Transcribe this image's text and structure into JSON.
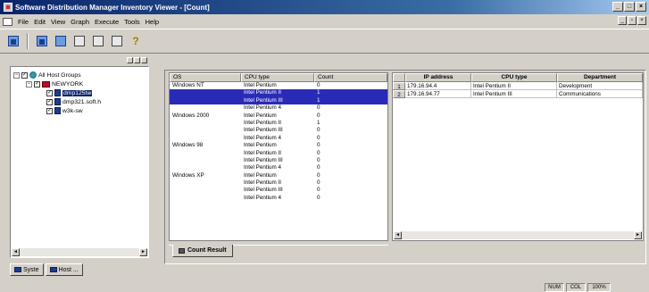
{
  "window": {
    "title": "Software Distribution Manager Inventory Viewer - [Count]",
    "controls": [
      "_",
      "□",
      "×"
    ]
  },
  "menu": {
    "items": [
      "File",
      "Edit",
      "View",
      "Graph",
      "Execute",
      "Tools",
      "Help"
    ],
    "mdi_controls": [
      "_",
      "▫",
      "×"
    ]
  },
  "tree": {
    "nodes": [
      {
        "label": "All Host Groups",
        "expander": "−"
      },
      {
        "label": "NEWYORK",
        "expander": "−"
      },
      {
        "label": "dmp125tw"
      },
      {
        "label": "dmp321.soft.h"
      },
      {
        "label": "w3k-sw"
      }
    ]
  },
  "left_tabs": [
    "Syste",
    "Host ..."
  ],
  "count_grid": {
    "columns": [
      "OS",
      "CPU type",
      "Count"
    ],
    "rows": [
      {
        "os": "Windows NT",
        "cpu": "Intel Pentium",
        "count": "0",
        "selected": false
      },
      {
        "os": "",
        "cpu": "Intel Pentium II",
        "count": "1",
        "selected": true
      },
      {
        "os": "",
        "cpu": "Intel Pentium III",
        "count": "1",
        "selected": true
      },
      {
        "os": "",
        "cpu": "Intel Pentium 4",
        "count": "0",
        "selected": false
      },
      {
        "os": "Windows 2000",
        "cpu": "Intel Pentium",
        "count": "0",
        "selected": false
      },
      {
        "os": "",
        "cpu": "Intel Pentium II",
        "count": "1",
        "selected": false
      },
      {
        "os": "",
        "cpu": "Intel Pentium III",
        "count": "0",
        "selected": false
      },
      {
        "os": "",
        "cpu": "Intel Pentium 4",
        "count": "0",
        "selected": false
      },
      {
        "os": "Windows 98",
        "cpu": "Intel Pentium",
        "count": "0",
        "selected": false
      },
      {
        "os": "",
        "cpu": "Intel Pentium II",
        "count": "0",
        "selected": false
      },
      {
        "os": "",
        "cpu": "Intel Pentium III",
        "count": "0",
        "selected": false
      },
      {
        "os": "",
        "cpu": "Intel Pentium 4",
        "count": "0",
        "selected": false
      },
      {
        "os": "Windows XP",
        "cpu": "Intel Pentium",
        "count": "0",
        "selected": false
      },
      {
        "os": "",
        "cpu": "Intel Pentium II",
        "count": "0",
        "selected": false
      },
      {
        "os": "",
        "cpu": "Intel Pentium III",
        "count": "0",
        "selected": false
      },
      {
        "os": "",
        "cpu": "Intel Pentium 4",
        "count": "0",
        "selected": false
      }
    ]
  },
  "result_tab": {
    "label": "Count Result"
  },
  "ip_grid": {
    "columns": [
      "IP address",
      "CPU type",
      "Department"
    ],
    "rows": [
      {
        "n": "1",
        "ip": "179.16.94.4",
        "cpu": "Intel Pentium II",
        "dept": "Development"
      },
      {
        "n": "2",
        "ip": "179.16.94.77",
        "cpu": "Intel Pentium III",
        "dept": "Communications"
      }
    ]
  },
  "status": [
    "NUM",
    "COL",
    "100%"
  ],
  "colors": {
    "title_start": "#0a246a",
    "selection": "#2a2ab8",
    "face": "#d4d0c8"
  }
}
